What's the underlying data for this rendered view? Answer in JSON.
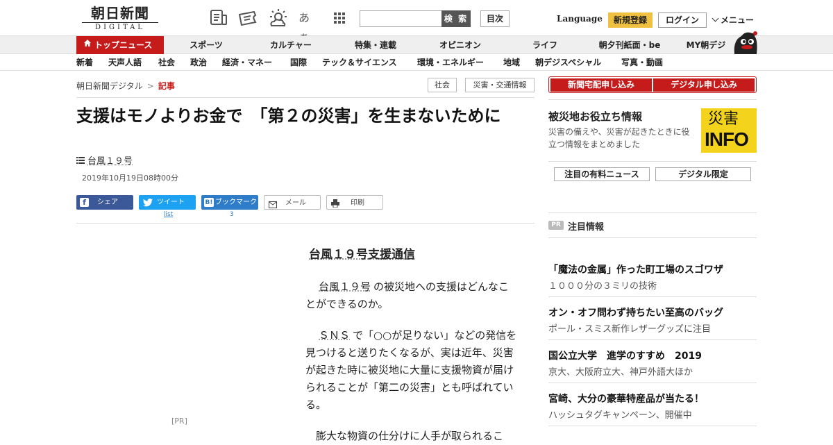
{
  "header": {
    "logo_ja": "朝日新聞",
    "logo_en": "DIGITAL",
    "search_button": "検 索",
    "toc_button": "目次",
    "language": "Language",
    "register": "新規登録",
    "login": "ログイン",
    "menu": "メニュー",
    "kana_icon": "あぁ"
  },
  "nav_primary": [
    "トップニュース",
    "スポーツ",
    "カルチャー",
    "特集・連載",
    "オピニオン",
    "ライフ",
    "朝夕刊紙面・be",
    "MY朝デジ"
  ],
  "nav_secondary": [
    "新着",
    "天声人語",
    "社会",
    "政治",
    "経済・マネー",
    "国際",
    "テック＆サイエンス",
    "環境・エネルギー",
    "地域",
    "朝デジスペシャル",
    "写真・動画"
  ],
  "breadcrumb": {
    "home": "朝日新聞デジタル",
    "sep": ">",
    "current": "記事"
  },
  "tags": [
    "社会",
    "災害・交通情報"
  ],
  "article": {
    "title": "支援はモノよりお金で　「第２の災害」を生まないために",
    "series_link": "台風１９号",
    "date": "2019年10月19日08時00分",
    "share": {
      "facebook": "シェア",
      "twitter": "ツイート",
      "twitter_count": "list",
      "hatena": "ブックマーク",
      "hatena_count": "3",
      "mail": "メール",
      "print": "印刷"
    },
    "ad_label": "[PR]",
    "body_title": "台風１９号支援通信",
    "p1_link": "台風１９号",
    "p1_text": "の被災地への支援はどんなことができるのか。",
    "p2_link": "ＳＮＳ",
    "p2_text": "で「○○が足りない」などの発信を見つけると送りたくなるが、実は近年、災害が起きた時に被災地に大量に支援物資が届けられることが「第二の災害」とも呼ばれている。",
    "p3_text": "膨大な物資の仕分けに人手が取られるこ"
  },
  "aside": {
    "buttons": [
      "新聞宅配申し込み",
      "デジタル申し込み"
    ],
    "disaster_title": "被災地お役立ち情報",
    "disaster_desc": "災害の備えや、災害が起きたときに役立つ情報をまとめました",
    "disaster_logo_top": "災害",
    "disaster_logo_bottom": "INFO",
    "small_buttons": [
      "注目の有料ニュース",
      "デジタル限定"
    ],
    "pr_badge": "PR",
    "pr_title": "注目情報",
    "pr_items": [
      {
        "head": "「魔法の金属」作った町工場のスゴワザ",
        "sub": "１０００分の３ミリの技術"
      },
      {
        "head": "オン・オフ問わず持ちたい至高のバッグ",
        "sub": "ポール・スミス新作レザーグッズに注目"
      },
      {
        "head": "国公立大学　進学のすすめ　2019",
        "sub": "京大、大阪府立大、神戸外語大ほか"
      },
      {
        "head": "宮崎、大分の豪華特産品が当たる！",
        "sub": "ハッシュタグキャンペーン、開催中"
      }
    ]
  },
  "colors": {
    "brand_red": "#c61b1b",
    "register_yellow": "#f0c040",
    "facebook": "#3b5998",
    "twitter": "#1da1f2",
    "hatena": "#2f7dc9",
    "disaster_yellow": "#f3d31c"
  }
}
